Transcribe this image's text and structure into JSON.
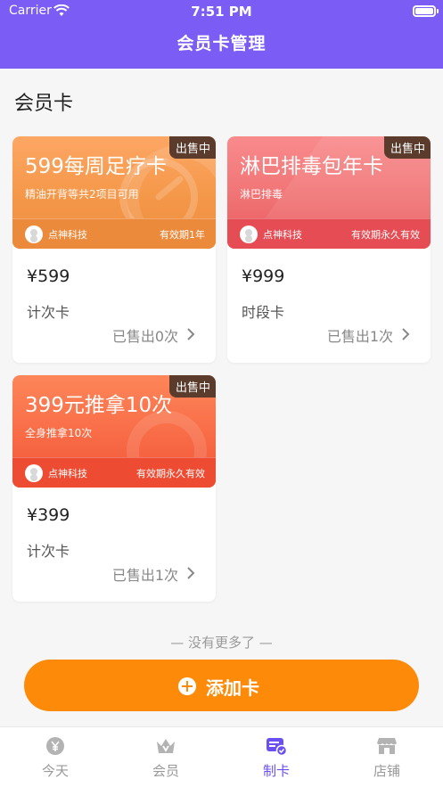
{
  "status_bar": {
    "carrier": "Carrier",
    "time": "7:51 PM"
  },
  "nav": {
    "title": "会员卡管理"
  },
  "section": {
    "title": "会员卡"
  },
  "cards": [
    {
      "name": "599每周足疗卡",
      "desc": "精油开背等共2项目可用",
      "badge": "出售中",
      "shop": "点神科技",
      "validity": "有效期1年",
      "price": "¥599",
      "type": "计次卡",
      "sold": "已售出0次",
      "theme": "orange"
    },
    {
      "name": "淋巴排毒包年卡",
      "desc": "淋巴排毒",
      "badge": "出售中",
      "shop": "点神科技",
      "validity": "有效期永久有效",
      "price": "¥999",
      "type": "时段卡",
      "sold": "已售出1次",
      "theme": "pink"
    },
    {
      "name": "399元推拿10次",
      "desc": "全身推拿10次",
      "badge": "出售中",
      "shop": "点神科技",
      "validity": "有效期永久有效",
      "price": "¥399",
      "type": "计次卡",
      "sold": "已售出1次",
      "theme": "red"
    }
  ],
  "list_end": "— 没有更多了 —",
  "add_button": {
    "label": "添加卡",
    "icon": "plus-circle-icon",
    "color": "#fd8b09"
  },
  "tabs": [
    {
      "label": "今天",
      "icon": "yen-coin-icon",
      "active": false
    },
    {
      "label": "会员",
      "icon": "crown-icon",
      "active": false
    },
    {
      "label": "制卡",
      "icon": "card-check-icon",
      "active": true
    },
    {
      "label": "店铺",
      "icon": "store-icon",
      "active": false
    }
  ],
  "colors": {
    "header": "#7b5cf5",
    "accent": "#fd8b09",
    "active_tab": "#6a4ff2"
  }
}
